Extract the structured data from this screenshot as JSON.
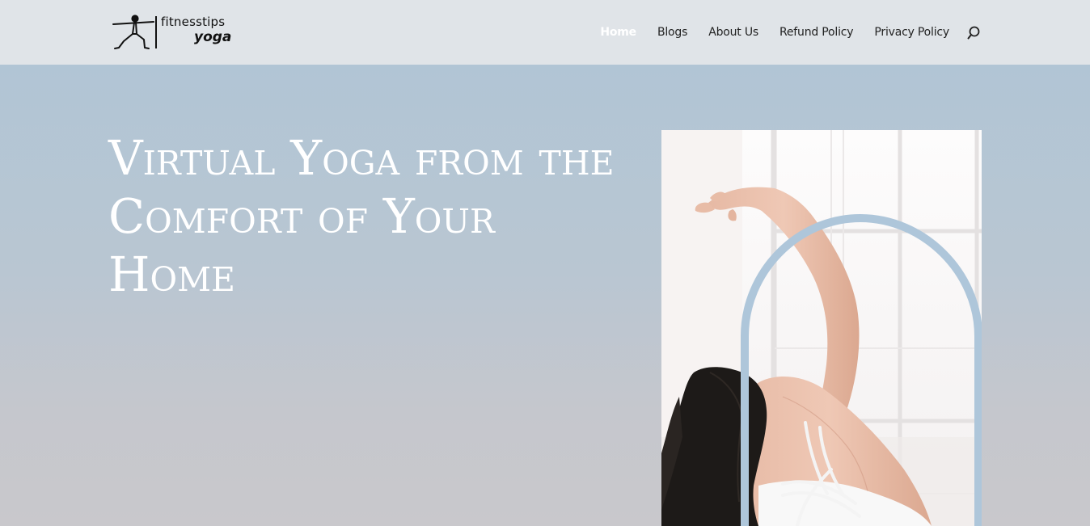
{
  "brand": {
    "line1": "fitnesstips",
    "line2": "yoga"
  },
  "nav": {
    "items": [
      {
        "label": "Home",
        "active": true
      },
      {
        "label": "Blogs",
        "active": false
      },
      {
        "label": "About Us",
        "active": false
      },
      {
        "label": "Refund Policy",
        "active": false
      },
      {
        "label": "Privacy Policy",
        "active": false
      }
    ],
    "search_icon": "search-icon"
  },
  "hero": {
    "title": "Virtual Yoga from the Comfort of Your Home",
    "image_icon": "yoga-woman-stretching-photo"
  },
  "colors": {
    "header_bg": "#e0e4e8",
    "hero_top": "#b1c5d5",
    "hero_bottom": "#c9c8cc",
    "arch": "#aec6da",
    "title_text": "#ffffff",
    "nav_text": "#222222"
  }
}
